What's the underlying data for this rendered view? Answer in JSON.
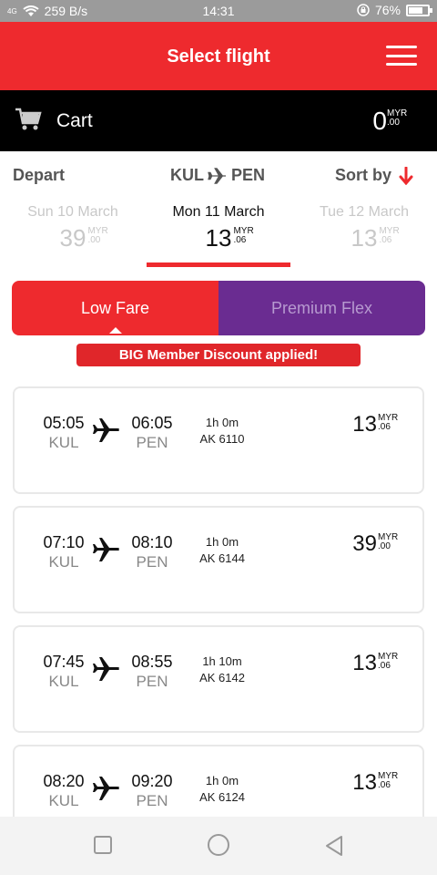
{
  "status_bar": {
    "network": "4G",
    "speed": "259 B/s",
    "time": "14:31",
    "battery": "76%"
  },
  "header": {
    "title": "Select flight",
    "menu_icon": "hamburger-menu-icon"
  },
  "cart": {
    "label": "Cart",
    "amount": "0",
    "currency": "MYR",
    "cents": ".00",
    "icon": "cart-icon"
  },
  "filter": {
    "depart_label": "Depart",
    "origin": "KUL",
    "destination": "PEN",
    "sort_label": "Sort by",
    "sort_icon": "arrow-down-icon"
  },
  "dates": [
    {
      "label": "Sun 10 March",
      "price": "39",
      "currency": "MYR",
      "cents": ".00",
      "active": false
    },
    {
      "label": "Mon 11 March",
      "price": "13",
      "currency": "MYR",
      "cents": ".06",
      "active": true
    },
    {
      "label": "Tue 12 March",
      "price": "13",
      "currency": "MYR",
      "cents": ".06",
      "active": false
    }
  ],
  "fares": {
    "low": "Low Fare",
    "premium": "Premium Flex",
    "selected": "low"
  },
  "discount_banner": "BIG Member Discount applied!",
  "flights": [
    {
      "dep_time": "05:05",
      "dep_code": "KUL",
      "arr_time": "06:05",
      "arr_code": "PEN",
      "duration": "1h 0m",
      "flight_no": "AK 6110",
      "price": "13",
      "currency": "MYR",
      "cents": ".06"
    },
    {
      "dep_time": "07:10",
      "dep_code": "KUL",
      "arr_time": "08:10",
      "arr_code": "PEN",
      "duration": "1h 0m",
      "flight_no": "AK 6144",
      "price": "39",
      "currency": "MYR",
      "cents": ".00"
    },
    {
      "dep_time": "07:45",
      "dep_code": "KUL",
      "arr_time": "08:55",
      "arr_code": "PEN",
      "duration": "1h 10m",
      "flight_no": "AK 6142",
      "price": "13",
      "currency": "MYR",
      "cents": ".06"
    },
    {
      "dep_time": "08:20",
      "dep_code": "KUL",
      "arr_time": "09:20",
      "arr_code": "PEN",
      "duration": "1h 0m",
      "flight_no": "AK 6124",
      "price": "13",
      "currency": "MYR",
      "cents": ".06"
    }
  ],
  "nav": {
    "recents_icon": "square-icon",
    "home_icon": "circle-icon",
    "back_icon": "triangle-back-icon"
  },
  "colors": {
    "brand_red": "#ee2a2e",
    "premium_purple": "#6a2c91",
    "cart_bar": "#000000",
    "status_bar": "#9b9b9b"
  }
}
